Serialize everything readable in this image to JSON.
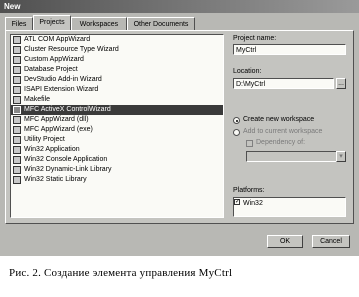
{
  "dialog": {
    "title": "New"
  },
  "tabs": [
    {
      "label": "Files"
    },
    {
      "label": "Projects"
    },
    {
      "label": "Workspaces"
    },
    {
      "label": "Other Documents"
    }
  ],
  "projects": {
    "items": [
      {
        "label": "ATL COM AppWizard",
        "icon": "atl-icon"
      },
      {
        "label": "Cluster Resource Type Wizard",
        "icon": "cluster-icon"
      },
      {
        "label": "Custom AppWizard",
        "icon": "wizard-icon"
      },
      {
        "label": "Database Project",
        "icon": "database-icon"
      },
      {
        "label": "DevStudio Add-in Wizard",
        "icon": "addin-icon"
      },
      {
        "label": "ISAPI Extension Wizard",
        "icon": "isapi-icon"
      },
      {
        "label": "Makefile",
        "icon": "makefile-icon"
      },
      {
        "label": "MFC ActiveX ControlWizard",
        "icon": "activex-icon",
        "selected": true
      },
      {
        "label": "MFC AppWizard (dll)",
        "icon": "mfc-dll-icon"
      },
      {
        "label": "MFC AppWizard (exe)",
        "icon": "mfc-exe-icon"
      },
      {
        "label": "Utility Project",
        "icon": "utility-icon"
      },
      {
        "label": "Win32 Application",
        "icon": "win32-app-icon"
      },
      {
        "label": "Win32 Console Application",
        "icon": "console-icon"
      },
      {
        "label": "Win32 Dynamic-Link Library",
        "icon": "dll-icon"
      },
      {
        "label": "Win32 Static Library",
        "icon": "lib-icon"
      }
    ]
  },
  "form": {
    "project_name_label": "Project name:",
    "project_name_value": "MyCtrl",
    "location_label": "Location:",
    "location_value": "D:\\MyCtrl",
    "browse_label": "...",
    "create_new_label": "Create new workspace",
    "add_current_label": "Add to current workspace",
    "dependency_label": "Dependency of:",
    "platforms_label": "Platforms:",
    "platform_value": "Win32"
  },
  "buttons": {
    "ok": "OK",
    "cancel": "Cancel"
  },
  "caption": "Рис. 2. Создание элемента управления MyCtrl"
}
